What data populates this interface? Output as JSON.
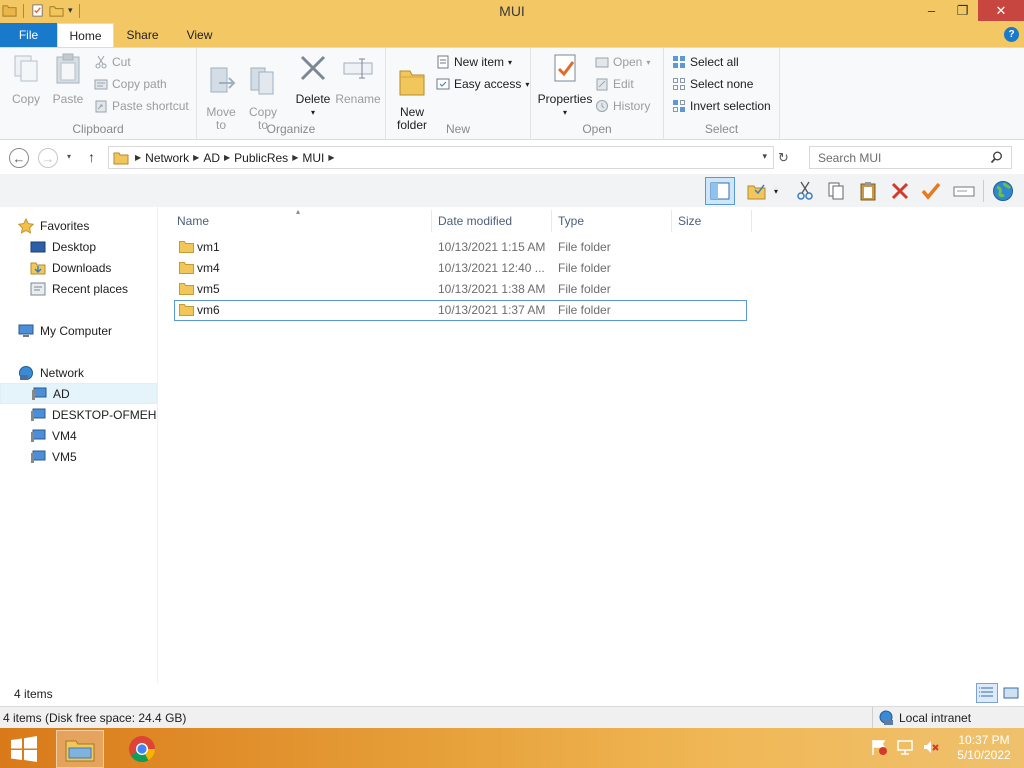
{
  "window": {
    "title": "MUI"
  },
  "title_buttons": {
    "minimize": "–",
    "maximize": "❐",
    "close": "✕"
  },
  "ribbon_tabs": {
    "file": "File",
    "home": "Home",
    "share": "Share",
    "view": "View",
    "help": "?"
  },
  "ribbon": {
    "clipboard": {
      "label": "Clipboard",
      "copy": "Copy",
      "paste": "Paste",
      "cut": "Cut",
      "copy_path": "Copy path",
      "paste_shortcut": "Paste shortcut"
    },
    "organize": {
      "label": "Organize",
      "move_to": "Move\nto",
      "copy_to": "Copy\nto",
      "delete": "Delete",
      "rename": "Rename"
    },
    "new": {
      "label": "New",
      "new_folder": "New\nfolder",
      "new_item": "New item",
      "easy_access": "Easy access"
    },
    "open": {
      "label": "Open",
      "properties": "Properties",
      "open": "Open",
      "edit": "Edit",
      "history": "History"
    },
    "select": {
      "label": "Select",
      "select_all": "Select all",
      "select_none": "Select none",
      "invert_selection": "Invert selection"
    }
  },
  "address": {
    "crumbs": [
      "Network",
      "AD",
      "PublicRes",
      "MUI"
    ]
  },
  "search": {
    "placeholder": "Search MUI"
  },
  "nav_pane": {
    "favorites": "Favorites",
    "desktop": "Desktop",
    "downloads": "Downloads",
    "recent_places": "Recent places",
    "my_computer": "My Computer",
    "network": "Network",
    "ad": "AD",
    "desktop_pc": "DESKTOP-OFMEHRC",
    "vm4": "VM4",
    "vm5": "VM5"
  },
  "columns": {
    "name": "Name",
    "date_modified": "Date modified",
    "type": "Type",
    "size": "Size"
  },
  "files": [
    {
      "name": "vm1",
      "date": "10/13/2021 1:15 AM",
      "type": "File folder"
    },
    {
      "name": "vm4",
      "date": "10/13/2021 12:40 ...",
      "type": "File folder"
    },
    {
      "name": "vm5",
      "date": "10/13/2021 1:38 AM",
      "type": "File folder"
    },
    {
      "name": "vm6",
      "date": "10/13/2021 1:37 AM",
      "type": "File folder"
    }
  ],
  "status": {
    "item_count": "4 items",
    "details": "4 items (Disk free space: 24.4 GB)",
    "zone": "Local intranet"
  },
  "clock": {
    "time": "10:37 PM",
    "date": "5/10/2022"
  },
  "colors": {
    "titlebar": "#f3c864",
    "file_tab": "#1979ca",
    "selection": "#e5f3fb",
    "focus_border": "#5a99d3"
  }
}
